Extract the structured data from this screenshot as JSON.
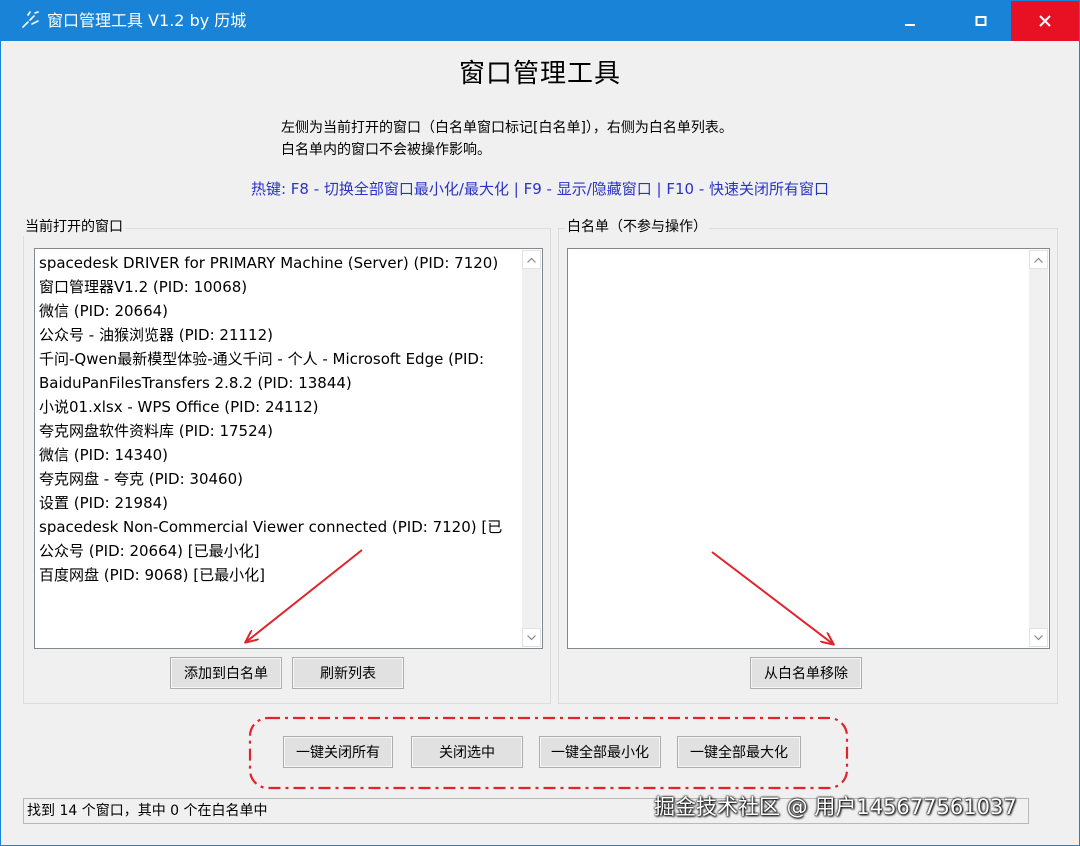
{
  "window": {
    "title": "窗口管理工具 V1.2 by 历城",
    "controls": {
      "minimize_icon": "minimize-icon",
      "maximize_icon": "maximize-icon",
      "close_icon": "close-icon"
    }
  },
  "header": {
    "title": "窗口管理工具",
    "description_line1": "左侧为当前打开的窗口（白名单窗口标记[白名单]），右侧为白名单列表。",
    "description_line2": "白名单内的窗口不会被操作影响。",
    "hotkeys": "热键: F8 - 切换全部窗口最小化/最大化 | F9 - 显示/隐藏窗口 | F10 - 快速关闭所有窗口"
  },
  "open_windows": {
    "label": "当前打开的窗口",
    "items": [
      "spacedesk DRIVER for PRIMARY Machine (Server) (PID: 7120)",
      "窗口管理器V1.2 (PID: 10068)",
      "微信 (PID: 20664)",
      "公众号 - 油猴浏览器 (PID: 21112)",
      "千问-Qwen最新模型体验-通义千问 - 个人 - Microsoft Edge (PID:",
      "BaiduPanFilesTransfers 2.8.2 (PID: 13844)",
      "小说01.xlsx - WPS Office (PID: 24112)",
      "夸克网盘软件资料库 (PID: 17524)",
      "微信 (PID: 14340)",
      "夸克网盘 - 夸克 (PID: 30460)",
      "设置 (PID: 21984)",
      "spacedesk Non-Commercial Viewer connected (PID: 7120)  [已",
      "公众号 (PID: 20664)  [已最小化]",
      "百度网盘 (PID: 9068)  [已最小化]"
    ],
    "add_button": "添加到白名单",
    "refresh_button": "刷新列表"
  },
  "whitelist": {
    "label": "白名单（不参与操作）",
    "items": [],
    "remove_button": "从白名单移除"
  },
  "actions": {
    "close_all": "一键关闭所有",
    "close_selected": "关闭选中",
    "minimize_all": "一键全部最小化",
    "maximize_all": "一键全部最大化"
  },
  "status": {
    "text": "找到 14 个窗口，其中 0 个在白名单中"
  },
  "watermark": "掘金技术社区 @ 用户145677561037",
  "colors": {
    "titlebar": "#1883d7",
    "close_hover": "#e81123",
    "hotkey_text": "#2a33c8",
    "annotation_red": "#e0242b"
  }
}
